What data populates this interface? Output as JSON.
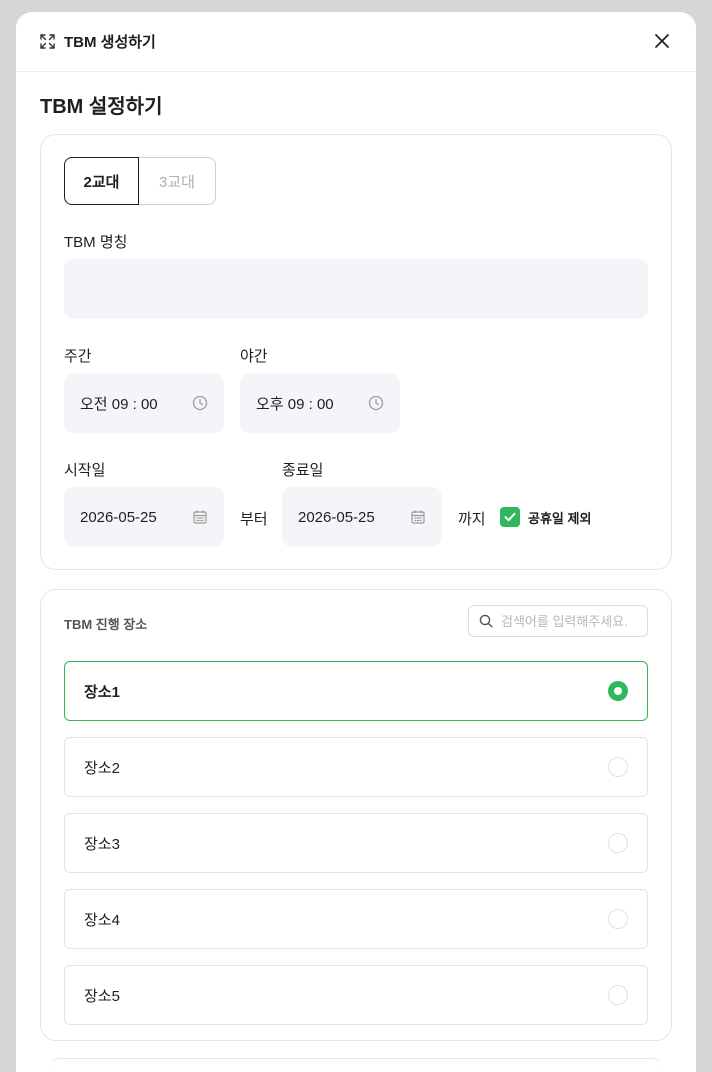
{
  "header": {
    "title": "TBM 생성하기"
  },
  "settings": {
    "title": "TBM 설정하기",
    "shifts": [
      {
        "label": "2교대",
        "active": true
      },
      {
        "label": "3교대",
        "active": false
      }
    ],
    "name_label": "TBM 명칭",
    "name_value": "",
    "day_label": "주간",
    "day_time": "오전 09 : 00",
    "night_label": "야간",
    "night_time": "오후 09 : 00",
    "start_label": "시작일",
    "start_date": "2026-05-25",
    "from_text": "부터",
    "end_label": "종료일",
    "end_date": "2026-05-25",
    "until_text": "까지",
    "holiday_label": "공휴일 제외",
    "holiday_checked": true
  },
  "places": {
    "title": "TBM 진행 장소",
    "search_placeholder": "검색어를 입력해주세요.",
    "items": [
      {
        "label": "장소1",
        "selected": true
      },
      {
        "label": "장소2",
        "selected": false
      },
      {
        "label": "장소3",
        "selected": false
      },
      {
        "label": "장소4",
        "selected": false
      },
      {
        "label": "장소5",
        "selected": false
      }
    ]
  },
  "colors": {
    "accent": "#2fb85c",
    "input_bg": "#f5f5f9",
    "border": "#e6e6e6"
  }
}
